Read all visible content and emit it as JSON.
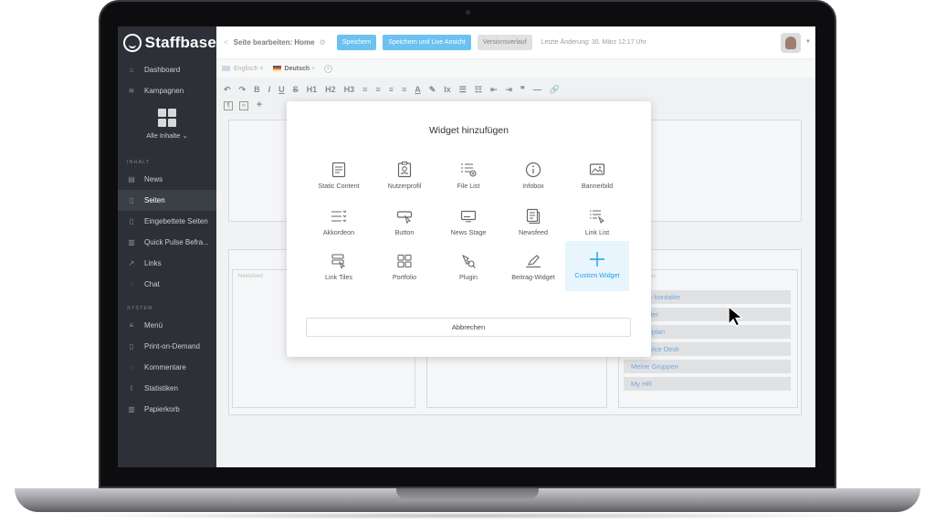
{
  "app": {
    "logo": "Staffbase"
  },
  "sidebar": {
    "items_top": [
      {
        "icon": "home-icon",
        "label": "Dashboard"
      },
      {
        "icon": "megaphone-icon",
        "label": "Kampagnen"
      }
    ],
    "all_content_label": "Alle Inhalte ⌄",
    "section_content": "INHALT",
    "items_content": [
      {
        "icon": "news-icon",
        "label": "News"
      },
      {
        "icon": "page-icon",
        "label": "Seiten"
      },
      {
        "icon": "embedded-page-icon",
        "label": "Eingebettete Seiten"
      },
      {
        "icon": "pulse-icon",
        "label": "Quick Pulse Befra..."
      },
      {
        "icon": "link-icon",
        "label": "Links"
      },
      {
        "icon": "chat-icon",
        "label": "Chat"
      }
    ],
    "section_system": "SYSTEM",
    "items_system": [
      {
        "icon": "menu-icon",
        "label": "Menü"
      },
      {
        "icon": "print-icon",
        "label": "Print-on-Demand"
      },
      {
        "icon": "comment-icon",
        "label": "Kommentare"
      },
      {
        "icon": "stats-icon",
        "label": "Statistiken"
      },
      {
        "icon": "trash-icon",
        "label": "Papierkorb"
      }
    ]
  },
  "header": {
    "back": "<",
    "title": "Seite bearbeiten: Home",
    "save": "Speichern",
    "save_live": "Speichern und Live Ansicht",
    "history": "Versionsverlauf",
    "last_change": "Letzte Änderung: 30. März 12:17 Uhr"
  },
  "languages": {
    "english": "Englisch",
    "german": "Deutsch",
    "close": "×"
  },
  "toolbar": {
    "row1": [
      "↶",
      "↷",
      "B",
      "I",
      "U",
      "S",
      "H1",
      "H2",
      "H3",
      "≡",
      "≡",
      "≡",
      "≡",
      "A",
      "✎",
      "Ix",
      "☰",
      "☷",
      "⇤",
      "⇥",
      "❞",
      "—",
      "🔗"
    ]
  },
  "editor": {
    "newsfeed_label": "Newsfeed",
    "links_label": "Links",
    "links": [
      "Notfall- kontakte",
      "Kalender",
      "Speiseplan",
      "IT Service Desk",
      "Meine Gruppen",
      "My HR"
    ]
  },
  "modal": {
    "title": "Widget hinzufügen",
    "widgets": [
      {
        "icon": "static-content-icon",
        "label": "Static Content"
      },
      {
        "icon": "user-profile-icon",
        "label": "Nutzerprofil"
      },
      {
        "icon": "file-list-icon",
        "label": "File List"
      },
      {
        "icon": "info-icon",
        "label": "Infobox"
      },
      {
        "icon": "banner-image-icon",
        "label": "Bannerbild"
      },
      {
        "icon": "accordion-icon",
        "label": "Akkordeon"
      },
      {
        "icon": "button-icon",
        "label": "Button"
      },
      {
        "icon": "news-stage-icon",
        "label": "News Stage"
      },
      {
        "icon": "newsfeed-icon",
        "label": "Newsfeed"
      },
      {
        "icon": "link-list-icon",
        "label": "Link List"
      },
      {
        "icon": "link-tiles-icon",
        "label": "Link Tiles"
      },
      {
        "icon": "portfolio-icon",
        "label": "Portfolio"
      },
      {
        "icon": "plugin-icon",
        "label": "Plugin"
      },
      {
        "icon": "post-widget-icon",
        "label": "Beitrag-Widget"
      },
      {
        "icon": "plus-icon",
        "label": "Custom Widget"
      }
    ],
    "cancel": "Abbrechen"
  },
  "colors": {
    "accent": "#1da1e8",
    "sidebar": "#2d3137"
  }
}
